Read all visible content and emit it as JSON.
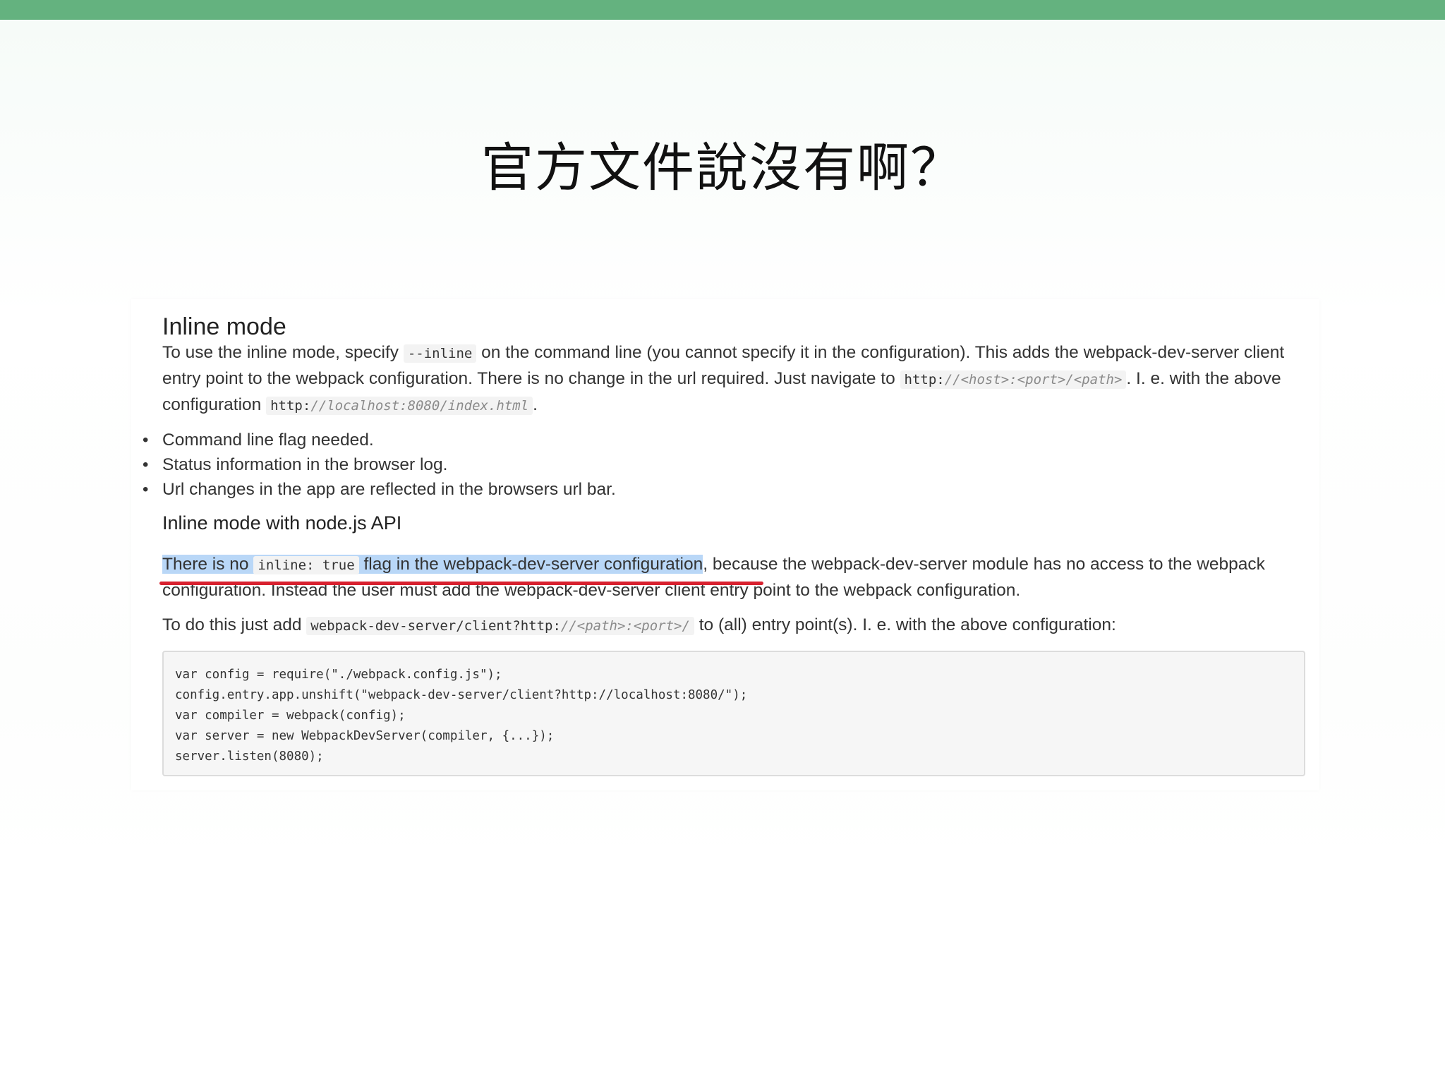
{
  "slide": {
    "title": "官方文件說沒有啊？",
    "accent_color": "#64b27f"
  },
  "doc": {
    "heading": "Inline mode",
    "intro": {
      "t1": "To use the inline mode, specify ",
      "code1": "--inline",
      "t2": " on the command line (you cannot specify it in the configuration). This adds the webpack-dev-server client entry point to the webpack configuration. There is no change in the url required. Just navigate to ",
      "code2_prefix": "http:",
      "code2_muted": "//<host>:<port>/<path>",
      "t3": ". I. e. with the above configuration ",
      "code3_prefix": "http:",
      "code3_muted": "//localhost:8080/index.html",
      "t4": "."
    },
    "bullets": [
      "Command line flag needed.",
      "Status information in the browser log.",
      "Url changes in the app are reflected in the browsers url bar."
    ],
    "subheading": "Inline mode with node.js API",
    "note": {
      "hl_t1": "There is no ",
      "hl_code": "inline: true",
      "hl_t2": " flag in the webpack-dev-server configuration",
      "rest": ", because the webpack-dev-server module has no access to the webpack configuration. Instead the user must add the webpack-dev-server client entry point to the webpack configuration.",
      "highlight_color": "#b9d7f7",
      "underline_color": "#d8212f"
    },
    "todo": {
      "t1": "To do this just add ",
      "code_prefix": "webpack-dev-server/client?http:",
      "code_muted": "//<path>:<port>/",
      "t2": " to (all) entry point(s). I. e. with the above configuration:"
    },
    "code_lines": [
      "var config = require(\"./webpack.config.js\");",
      "config.entry.app.unshift(\"webpack-dev-server/client?http://localhost:8080/\");",
      "var compiler = webpack(config);",
      "var server = new WebpackDevServer(compiler, {...});",
      "server.listen(8080);"
    ]
  }
}
